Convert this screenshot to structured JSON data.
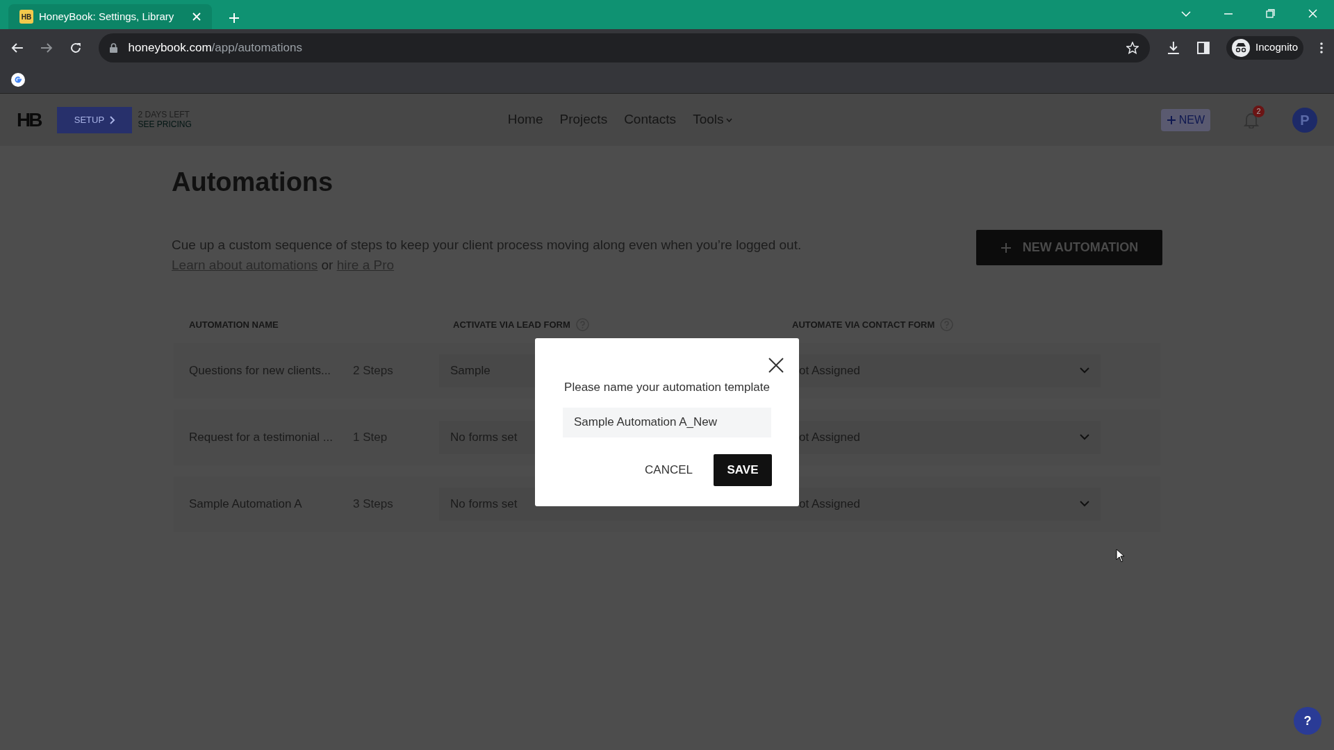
{
  "browser": {
    "tab_title": "HoneyBook: Settings, Library",
    "tab_favicon": "HB",
    "url_host": "honeybook.com",
    "url_path": "/app/automations",
    "profile_label": "Incognito"
  },
  "header": {
    "logo": "HB",
    "setup_label": "SETUP",
    "trial_days": "2 DAYS LEFT",
    "trial_link": "SEE PRICING",
    "nav": [
      {
        "label": "Home",
        "dropdown": false
      },
      {
        "label": "Projects",
        "dropdown": false
      },
      {
        "label": "Contacts",
        "dropdown": false
      },
      {
        "label": "Tools",
        "dropdown": true
      }
    ],
    "new_label": "NEW",
    "notification_count": "2",
    "avatar_initial": "P"
  },
  "page": {
    "title": "Automations",
    "description": "Cue up a custom sequence of steps to keep your client process moving along even when you’re logged out.",
    "link_learn": "Learn about automations",
    "joiner": "or",
    "link_pro": "hire a Pro",
    "new_automation_label": "NEW AUTOMATION"
  },
  "table": {
    "columns": [
      {
        "label": "AUTOMATION NAME",
        "help": false
      },
      {
        "label": "ACTIVATE VIA LEAD FORM",
        "help": true
      },
      {
        "label": "AUTOMATE VIA CONTACT FORM",
        "help": true
      }
    ],
    "rows": [
      {
        "name": "Questions for new clients...",
        "steps": "2 Steps",
        "lead_form": "Sample",
        "contact_form": "ot Assigned"
      },
      {
        "name": "Request for a testimonial ...",
        "steps": "1 Step",
        "lead_form": "No forms set",
        "contact_form": "ot Assigned"
      },
      {
        "name": "Sample Automation A",
        "steps": "3 Steps",
        "lead_form": "No forms set",
        "contact_form": "ot Assigned"
      }
    ]
  },
  "modal": {
    "prompt": "Please name your automation template",
    "value": "Sample Automation A_New",
    "cancel": "CANCEL",
    "save": "SAVE"
  },
  "help_button": "?"
}
